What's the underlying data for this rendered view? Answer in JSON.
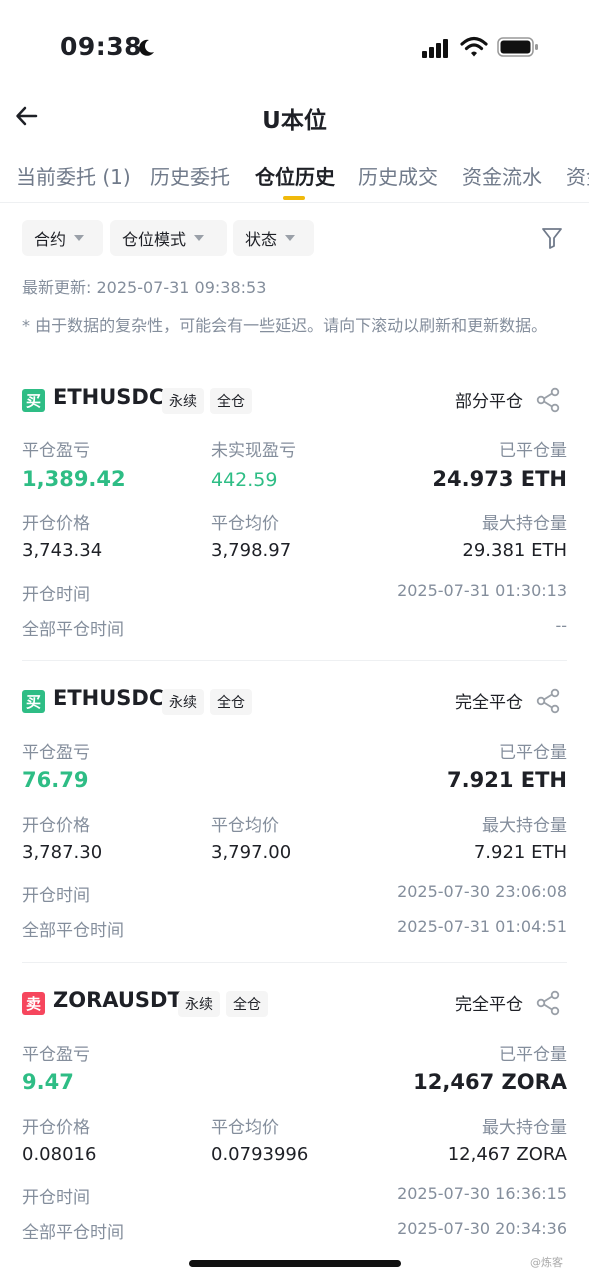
{
  "status_bar": {
    "time": "09:38"
  },
  "nav": {
    "title": "U本位"
  },
  "tabs": [
    {
      "label": "当前委托 (1)"
    },
    {
      "label": "历史委托"
    },
    {
      "label": "仓位历史"
    },
    {
      "label": "历史成交"
    },
    {
      "label": "资金流水"
    },
    {
      "label": "资金"
    }
  ],
  "filters": {
    "contract": "合约",
    "position_mode": "仓位模式",
    "status": "状态"
  },
  "last_update": "最新更新: 2025-07-31 09:38:53",
  "notice": "* 由于数据的复杂性，可能会有一些延迟。请向下滚动以刷新和更新数据。",
  "labels": {
    "close_pnl": "平仓盈亏",
    "unrealized_pnl": "未实现盈亏",
    "closed_qty": "已平仓量",
    "open_price": "开仓价格",
    "avg_close_price": "平仓均价",
    "max_position": "最大持仓量",
    "open_time": "开仓时间",
    "full_close_time": "全部平仓时间"
  },
  "positions": [
    {
      "side": "买",
      "symbol": "ETHUSDC",
      "tag_type": "永续",
      "tag_margin": "全仓",
      "status": "部分平仓",
      "close_pnl": "1,389.42",
      "unrealized_pnl": "442.59",
      "closed_qty": "24.973 ETH",
      "open_price": "3,743.34",
      "avg_close_price": "3,798.97",
      "max_position": "29.381 ETH",
      "open_time": "2025-07-31 01:30:13",
      "full_close_time": "--"
    },
    {
      "side": "买",
      "symbol": "ETHUSDC",
      "tag_type": "永续",
      "tag_margin": "全仓",
      "status": "完全平仓",
      "close_pnl": "76.79",
      "closed_qty": "7.921 ETH",
      "open_price": "3,787.30",
      "avg_close_price": "3,797.00",
      "max_position": "7.921 ETH",
      "open_time": "2025-07-30 23:06:08",
      "full_close_time": "2025-07-31 01:04:51"
    },
    {
      "side": "卖",
      "symbol": "ZORAUSDT",
      "tag_type": "永续",
      "tag_margin": "全仓",
      "status": "完全平仓",
      "close_pnl": "9.47",
      "closed_qty": "12,467 ZORA",
      "open_price": "0.08016",
      "avg_close_price": "0.0793996",
      "max_position": "12,467 ZORA",
      "open_time": "2025-07-30 16:36:15",
      "full_close_time": "2025-07-30 20:34:36"
    }
  ],
  "watermark": "@炼客",
  "colors": {
    "accent": "#f0b90b",
    "buy": "#2ebd85",
    "sell": "#f6465d",
    "secondary_text": "#848e9c"
  }
}
